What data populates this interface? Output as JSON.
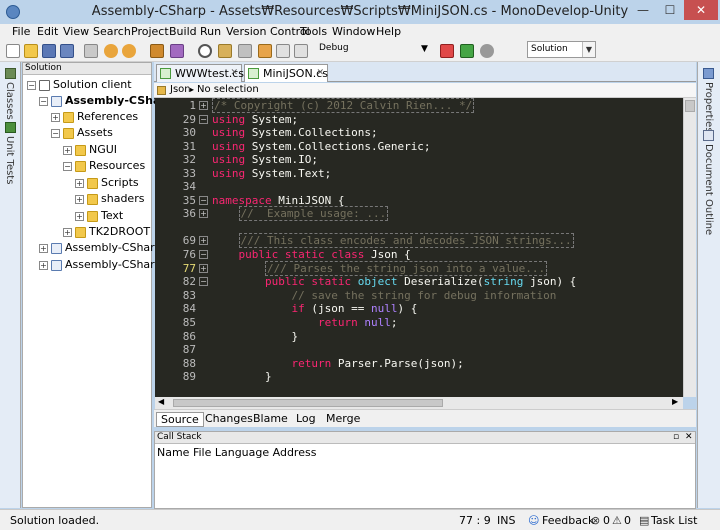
{
  "window": {
    "title": "Assembly-CSharp - Assets₩Resources₩Scripts₩MiniJSON.cs - MonoDevelop-Unity",
    "minimize": "—",
    "maximize": "☐",
    "close": "✕"
  },
  "menu": [
    "File",
    "Edit",
    "View",
    "Search",
    "Project",
    "Build",
    "Run",
    "Version Control",
    "Tools",
    "Window",
    "Help"
  ],
  "toolbar": {
    "config": "Debug",
    "platform": "Solution"
  },
  "side_tabs": {
    "classes": "Classes",
    "unit_tests": "Unit Tests",
    "properties": "Properties",
    "document_outline": "Document Outline"
  },
  "solution": {
    "header": "Solution",
    "nodes": [
      {
        "label": "Solution client",
        "bold": false
      },
      {
        "label": "Assembly-CSharp",
        "bold": true
      },
      {
        "label": "References",
        "bold": false
      },
      {
        "label": "Assets",
        "bold": false
      },
      {
        "label": "NGUI",
        "bold": false
      },
      {
        "label": "Resources",
        "bold": false
      },
      {
        "label": "Scripts",
        "bold": false
      },
      {
        "label": "shaders",
        "bold": false
      },
      {
        "label": "Text",
        "bold": false
      },
      {
        "label": "TK2DROOT",
        "bold": false
      },
      {
        "label": "Assembly-CSharp-E",
        "bold": false
      },
      {
        "label": "Assembly-CSharp-fi",
        "bold": false
      }
    ]
  },
  "editor": {
    "tabs": [
      "WWWtest.cs",
      "MiniJSON.cs"
    ],
    "breadcrumb": {
      "type": "Json",
      "member": "No selection"
    },
    "line_numbers": [
      "1",
      "29",
      "30",
      "31",
      "32",
      "33",
      "34",
      "35",
      "36",
      "69",
      "76",
      "77",
      "82",
      "83",
      "84",
      "85",
      "86",
      "87",
      "88",
      "89"
    ],
    "bottom_tabs": [
      "Source",
      "Changes",
      "Blame",
      "Log",
      "Merge"
    ]
  },
  "callstack": {
    "header": "Call Stack",
    "columns": "Name File Language Address"
  },
  "status": {
    "message": "Solution loaded.",
    "position": "77 : 9",
    "mode": "INS",
    "feedback": "Feedback",
    "errors": "0",
    "warnings": "0",
    "task_list": "Task List"
  },
  "colors": {
    "editor_bg": "#272822",
    "keyword": "#f92672",
    "type": "#66d9ef",
    "comment": "#75715e",
    "literal": "#ae81ff"
  }
}
